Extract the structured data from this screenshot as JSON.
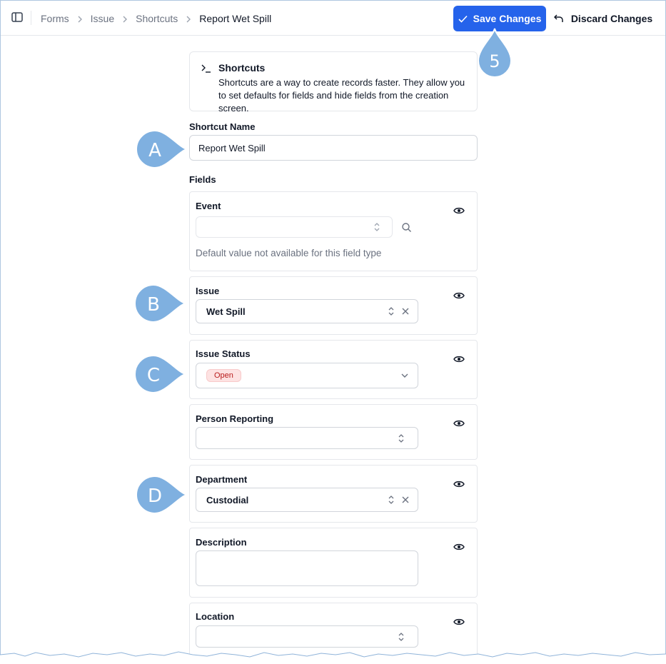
{
  "topbar": {
    "breadcrumb": [
      "Forms",
      "Issue",
      "Shortcuts",
      "Report Wet Spill"
    ],
    "save_label": "Save Changes",
    "discard_label": "Discard Changes"
  },
  "info": {
    "title": "Shortcuts",
    "description": "Shortcuts are a way to create records faster. They allow you to set defaults for fields and hide fields from the creation screen."
  },
  "shortcut_name": {
    "label": "Shortcut Name",
    "value": "Report Wet Spill"
  },
  "fields_label": "Fields",
  "fields": {
    "event": {
      "label": "Event",
      "hint": "Default value not available for this field type"
    },
    "issue": {
      "label": "Issue",
      "value": "Wet Spill"
    },
    "issue_status": {
      "label": "Issue Status",
      "value": "Open"
    },
    "person_reporting": {
      "label": "Person Reporting"
    },
    "department": {
      "label": "Department",
      "value": "Custodial"
    },
    "description": {
      "label": "Description"
    },
    "location": {
      "label": "Location"
    }
  },
  "markers": {
    "save": "5",
    "a": "A",
    "b": "B",
    "c": "C",
    "d": "D"
  },
  "colors": {
    "primary": "#2563eb",
    "marker": "#7fb0e0",
    "badge_bg": "#fde2e2",
    "badge_text": "#b91c1c"
  }
}
